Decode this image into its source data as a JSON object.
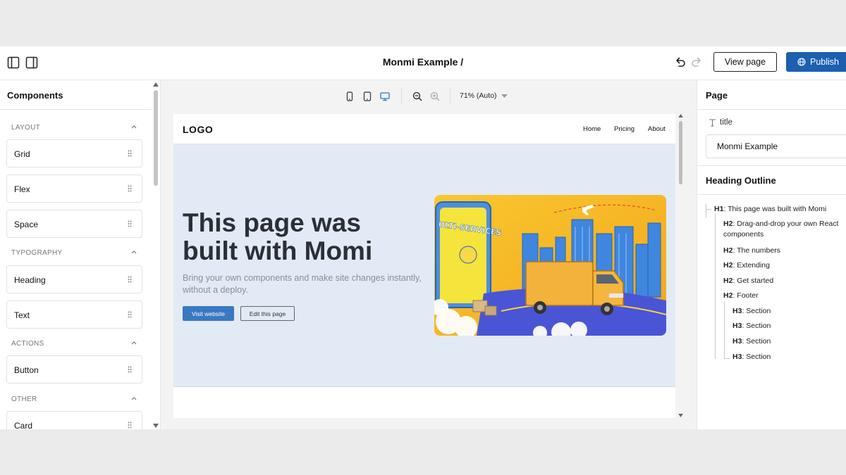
{
  "topbar": {
    "doc_title": "Monmi Example /",
    "view_label": "View page",
    "publish_label": "Publish"
  },
  "left_panel": {
    "title": "Components",
    "sections": [
      {
        "label": "LAYOUT",
        "items": [
          "Grid",
          "Flex",
          "Space"
        ]
      },
      {
        "label": "TYPOGRAPHY",
        "items": [
          "Heading",
          "Text"
        ]
      },
      {
        "label": "ACTIONS",
        "items": [
          "Button"
        ]
      },
      {
        "label": "OTHER",
        "items": [
          "Card"
        ]
      }
    ]
  },
  "canvas": {
    "zoom_label": "71% (Auto)",
    "site": {
      "logo": "LOGO",
      "nav": [
        "Home",
        "Pricing",
        "About"
      ],
      "hero": {
        "title": "This page was built with Momi",
        "subtitle": "Bring your own components and make site changes instantly, without a deploy.",
        "primary_button": "Visit website",
        "secondary_button": "Edit this page"
      }
    }
  },
  "right_panel": {
    "title": "Page",
    "prop_label": "title",
    "title_value": "Monmi Example",
    "outline_title": "Heading Outline",
    "outline": [
      {
        "level": "H1",
        "text": "This page was built with Momi"
      },
      {
        "level": "H2",
        "text": "Drag-and-drop your own React",
        "text2": "components"
      },
      {
        "level": "H2",
        "text": "The numbers"
      },
      {
        "level": "H2",
        "text": "Extending"
      },
      {
        "level": "H2",
        "text": "Get started"
      },
      {
        "level": "H2",
        "text": "Footer"
      },
      {
        "level": "H3",
        "text": "Section"
      },
      {
        "level": "H3",
        "text": "Section"
      },
      {
        "level": "H3",
        "text": "Section"
      },
      {
        "level": "H3",
        "text": "Section"
      }
    ]
  },
  "colors": {
    "publish": "#1d5fb0",
    "hero_bg": "#e2eaf5",
    "hero_button": "#3a78c2",
    "active_device": "#2b78c9"
  }
}
